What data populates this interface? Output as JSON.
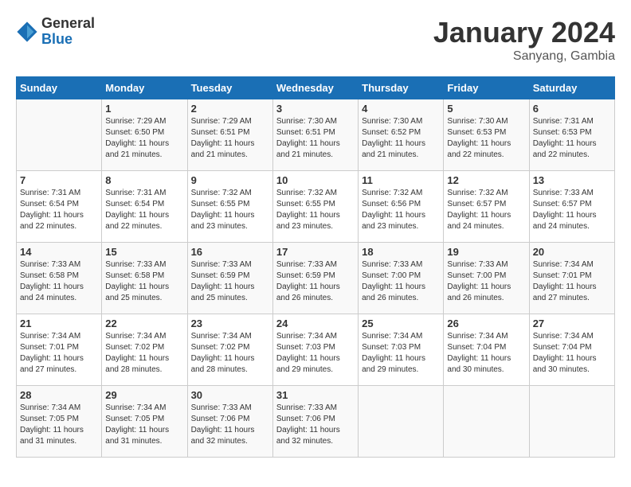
{
  "header": {
    "logo_general": "General",
    "logo_blue": "Blue",
    "month": "January 2024",
    "location": "Sanyang, Gambia"
  },
  "weekdays": [
    "Sunday",
    "Monday",
    "Tuesday",
    "Wednesday",
    "Thursday",
    "Friday",
    "Saturday"
  ],
  "weeks": [
    [
      {
        "day": "",
        "content": ""
      },
      {
        "day": "1",
        "content": "Sunrise: 7:29 AM\nSunset: 6:50 PM\nDaylight: 11 hours\nand 21 minutes."
      },
      {
        "day": "2",
        "content": "Sunrise: 7:29 AM\nSunset: 6:51 PM\nDaylight: 11 hours\nand 21 minutes."
      },
      {
        "day": "3",
        "content": "Sunrise: 7:30 AM\nSunset: 6:51 PM\nDaylight: 11 hours\nand 21 minutes."
      },
      {
        "day": "4",
        "content": "Sunrise: 7:30 AM\nSunset: 6:52 PM\nDaylight: 11 hours\nand 21 minutes."
      },
      {
        "day": "5",
        "content": "Sunrise: 7:30 AM\nSunset: 6:53 PM\nDaylight: 11 hours\nand 22 minutes."
      },
      {
        "day": "6",
        "content": "Sunrise: 7:31 AM\nSunset: 6:53 PM\nDaylight: 11 hours\nand 22 minutes."
      }
    ],
    [
      {
        "day": "7",
        "content": "Sunrise: 7:31 AM\nSunset: 6:54 PM\nDaylight: 11 hours\nand 22 minutes."
      },
      {
        "day": "8",
        "content": "Sunrise: 7:31 AM\nSunset: 6:54 PM\nDaylight: 11 hours\nand 22 minutes."
      },
      {
        "day": "9",
        "content": "Sunrise: 7:32 AM\nSunset: 6:55 PM\nDaylight: 11 hours\nand 23 minutes."
      },
      {
        "day": "10",
        "content": "Sunrise: 7:32 AM\nSunset: 6:55 PM\nDaylight: 11 hours\nand 23 minutes."
      },
      {
        "day": "11",
        "content": "Sunrise: 7:32 AM\nSunset: 6:56 PM\nDaylight: 11 hours\nand 23 minutes."
      },
      {
        "day": "12",
        "content": "Sunrise: 7:32 AM\nSunset: 6:57 PM\nDaylight: 11 hours\nand 24 minutes."
      },
      {
        "day": "13",
        "content": "Sunrise: 7:33 AM\nSunset: 6:57 PM\nDaylight: 11 hours\nand 24 minutes."
      }
    ],
    [
      {
        "day": "14",
        "content": "Sunrise: 7:33 AM\nSunset: 6:58 PM\nDaylight: 11 hours\nand 24 minutes."
      },
      {
        "day": "15",
        "content": "Sunrise: 7:33 AM\nSunset: 6:58 PM\nDaylight: 11 hours\nand 25 minutes."
      },
      {
        "day": "16",
        "content": "Sunrise: 7:33 AM\nSunset: 6:59 PM\nDaylight: 11 hours\nand 25 minutes."
      },
      {
        "day": "17",
        "content": "Sunrise: 7:33 AM\nSunset: 6:59 PM\nDaylight: 11 hours\nand 26 minutes."
      },
      {
        "day": "18",
        "content": "Sunrise: 7:33 AM\nSunset: 7:00 PM\nDaylight: 11 hours\nand 26 minutes."
      },
      {
        "day": "19",
        "content": "Sunrise: 7:33 AM\nSunset: 7:00 PM\nDaylight: 11 hours\nand 26 minutes."
      },
      {
        "day": "20",
        "content": "Sunrise: 7:34 AM\nSunset: 7:01 PM\nDaylight: 11 hours\nand 27 minutes."
      }
    ],
    [
      {
        "day": "21",
        "content": "Sunrise: 7:34 AM\nSunset: 7:01 PM\nDaylight: 11 hours\nand 27 minutes."
      },
      {
        "day": "22",
        "content": "Sunrise: 7:34 AM\nSunset: 7:02 PM\nDaylight: 11 hours\nand 28 minutes."
      },
      {
        "day": "23",
        "content": "Sunrise: 7:34 AM\nSunset: 7:02 PM\nDaylight: 11 hours\nand 28 minutes."
      },
      {
        "day": "24",
        "content": "Sunrise: 7:34 AM\nSunset: 7:03 PM\nDaylight: 11 hours\nand 29 minutes."
      },
      {
        "day": "25",
        "content": "Sunrise: 7:34 AM\nSunset: 7:03 PM\nDaylight: 11 hours\nand 29 minutes."
      },
      {
        "day": "26",
        "content": "Sunrise: 7:34 AM\nSunset: 7:04 PM\nDaylight: 11 hours\nand 30 minutes."
      },
      {
        "day": "27",
        "content": "Sunrise: 7:34 AM\nSunset: 7:04 PM\nDaylight: 11 hours\nand 30 minutes."
      }
    ],
    [
      {
        "day": "28",
        "content": "Sunrise: 7:34 AM\nSunset: 7:05 PM\nDaylight: 11 hours\nand 31 minutes."
      },
      {
        "day": "29",
        "content": "Sunrise: 7:34 AM\nSunset: 7:05 PM\nDaylight: 11 hours\nand 31 minutes."
      },
      {
        "day": "30",
        "content": "Sunrise: 7:33 AM\nSunset: 7:06 PM\nDaylight: 11 hours\nand 32 minutes."
      },
      {
        "day": "31",
        "content": "Sunrise: 7:33 AM\nSunset: 7:06 PM\nDaylight: 11 hours\nand 32 minutes."
      },
      {
        "day": "",
        "content": ""
      },
      {
        "day": "",
        "content": ""
      },
      {
        "day": "",
        "content": ""
      }
    ]
  ]
}
